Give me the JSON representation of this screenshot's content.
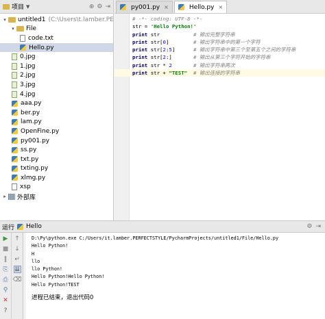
{
  "project": {
    "header_label": "项目",
    "tree": [
      {
        "label": "untitled1",
        "extra": "(C:\\Users\\t.lamber.PERFECTSTYLE...",
        "type": "folder",
        "arrow": "▾",
        "indent": 0
      },
      {
        "label": "File",
        "type": "folder",
        "arrow": "▾",
        "indent": 1
      },
      {
        "label": "code.txt",
        "type": "file",
        "indent": 2
      },
      {
        "label": "Hello.py",
        "type": "py",
        "indent": 2,
        "selected": true
      },
      {
        "label": "0.jpg",
        "type": "jpg",
        "indent": 1
      },
      {
        "label": "1.jpg",
        "type": "jpg",
        "indent": 1
      },
      {
        "label": "2.jpg",
        "type": "jpg",
        "indent": 1
      },
      {
        "label": "3.jpg",
        "type": "jpg",
        "indent": 1
      },
      {
        "label": "4.jpg",
        "type": "jpg",
        "indent": 1
      },
      {
        "label": "aaa.py",
        "type": "py",
        "indent": 1
      },
      {
        "label": "ber.py",
        "type": "py",
        "indent": 1
      },
      {
        "label": "lam.py",
        "type": "py",
        "indent": 1
      },
      {
        "label": "OpenFine.py",
        "type": "py",
        "indent": 1
      },
      {
        "label": "py001.py",
        "type": "py",
        "indent": 1
      },
      {
        "label": "ss.py",
        "type": "py",
        "indent": 1
      },
      {
        "label": "txt.py",
        "type": "py",
        "indent": 1
      },
      {
        "label": "txting.py",
        "type": "py",
        "indent": 1
      },
      {
        "label": "xlmg.py",
        "type": "py",
        "indent": 1
      },
      {
        "label": "xsp",
        "type": "file",
        "indent": 1
      },
      {
        "label": "外部库",
        "type": "lib",
        "arrow": "▸",
        "indent": 0
      }
    ]
  },
  "editor": {
    "tabs": [
      {
        "label": "py001.py",
        "active": false
      },
      {
        "label": "Hello.py",
        "active": true
      }
    ],
    "code_lines": [
      [
        {
          "t": "# -*- coding: UTF-8 -*-",
          "c": "cmt"
        }
      ],
      [
        {
          "t": "str = ",
          "c": ""
        },
        {
          "t": "'Hello Python!'",
          "c": "str"
        }
      ],
      [
        {
          "t": "print",
          "c": "kw"
        },
        {
          "t": " str           ",
          "c": ""
        },
        {
          "t": "# 输出完整字符串",
          "c": "cmt"
        }
      ],
      [
        {
          "t": "print",
          "c": "kw"
        },
        {
          "t": " str[",
          "c": ""
        },
        {
          "t": "0",
          "c": "num"
        },
        {
          "t": "]        ",
          "c": ""
        },
        {
          "t": "# 输出字符串中的第一个字符",
          "c": "cmt"
        }
      ],
      [
        {
          "t": "print",
          "c": "kw"
        },
        {
          "t": " str[",
          "c": ""
        },
        {
          "t": "2",
          "c": "num"
        },
        {
          "t": ":",
          "c": ""
        },
        {
          "t": "5",
          "c": "num"
        },
        {
          "t": "]      ",
          "c": ""
        },
        {
          "t": "# 输出字符串中第三个至第五个之间的字符串",
          "c": "cmt"
        }
      ],
      [
        {
          "t": "print",
          "c": "kw"
        },
        {
          "t": " str[",
          "c": ""
        },
        {
          "t": "2",
          "c": "num"
        },
        {
          "t": ":]       ",
          "c": ""
        },
        {
          "t": "# 输出从第三个字符开始的字符串",
          "c": "cmt"
        }
      ],
      [
        {
          "t": "print",
          "c": "kw"
        },
        {
          "t": " str * ",
          "c": ""
        },
        {
          "t": "2",
          "c": "num"
        },
        {
          "t": "       ",
          "c": ""
        },
        {
          "t": "# 输出字符串两次",
          "c": "cmt"
        }
      ],
      [
        {
          "t": "print",
          "c": "kw"
        },
        {
          "t": " str + ",
          "c": ""
        },
        {
          "t": "\"TEST\"",
          "c": "str"
        },
        {
          "t": "  ",
          "c": ""
        },
        {
          "t": "# 输出连接的字符串",
          "c": "cmt"
        }
      ]
    ],
    "current_line": 7
  },
  "run": {
    "header_label": "运行",
    "config_name": "Hello",
    "output_lines": [
      "D:\\Py\\python.exe C:/Users/it.lamber.PERFECTSTYLE/PycharmProjects/untitled1/File/Hello.py",
      "Hello Python!",
      "H",
      "llo",
      "llo Python!",
      "Hello Python!Hello Python!",
      "Hello Python!TEST"
    ],
    "finish_message": "进程已结束，退出代码0"
  },
  "colors": {
    "accent": "#3d7ab8",
    "selection": "#d0d8e8",
    "current_line": "#fffae3"
  }
}
